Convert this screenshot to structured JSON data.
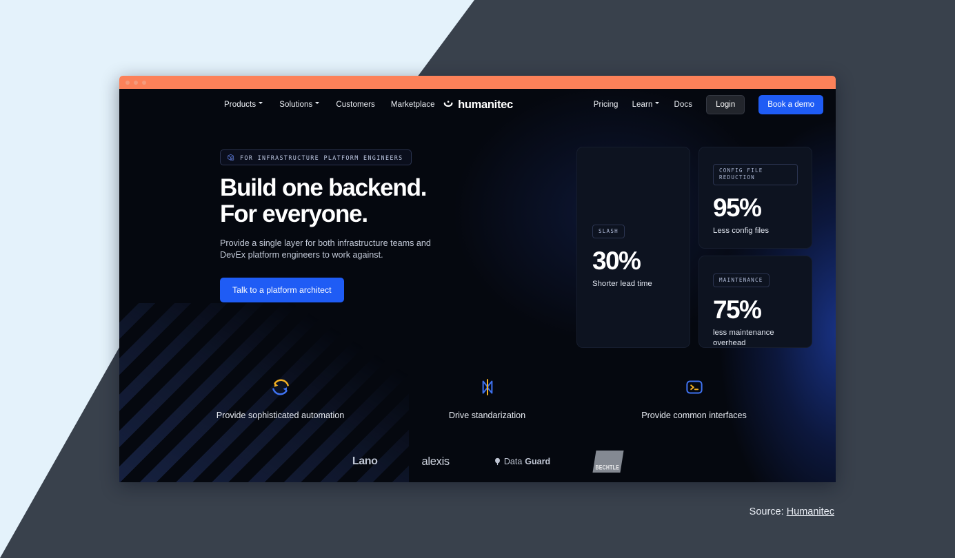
{
  "window": {
    "titlebar_dots": 3
  },
  "nav": {
    "left_items": [
      {
        "label": "Products",
        "has_chevron": true
      },
      {
        "label": "Solutions",
        "has_chevron": true
      },
      {
        "label": "Customers",
        "has_chevron": false
      },
      {
        "label": "Marketplace",
        "has_chevron": false
      }
    ],
    "brand": "humanitec",
    "brand_icon": "humanitec-smile-icon",
    "right_items": [
      {
        "label": "Pricing",
        "has_chevron": false
      },
      {
        "label": "Learn",
        "has_chevron": true
      },
      {
        "label": "Docs",
        "has_chevron": false
      }
    ],
    "login_label": "Login",
    "demo_label": "Book a demo"
  },
  "hero": {
    "eyebrow": "FOR INFRASTRUCTURE PLATFORM ENGINEERS",
    "eyebrow_icon": "cube-config-icon",
    "title_line1": "Build one backend.",
    "title_line2": "For everyone.",
    "subtitle": "Provide a single layer for both infrastructure teams and DevEx platform engineers to work against.",
    "cta_label": "Talk to a platform architect"
  },
  "stats": [
    {
      "tag": "SLASH",
      "value": "30%",
      "label": "Shorter lead time"
    },
    {
      "tag": "CONFIG FILE REDUCTION",
      "value": "95%",
      "label": "Less config files"
    },
    {
      "tag": "MAINTENANCE",
      "value": "75%",
      "label": "less maintenance overhead"
    }
  ],
  "features": [
    {
      "icon": "refresh-cycle-icon",
      "label": "Provide sophisticated automation"
    },
    {
      "icon": "standardization-brackets-icon",
      "label": "Drive standarization"
    },
    {
      "icon": "terminal-prompt-icon",
      "label": "Provide common interfaces"
    }
  ],
  "logos": [
    {
      "name": "lano-logo",
      "text": "Lano"
    },
    {
      "name": "alexis-logo",
      "text": "alexis"
    },
    {
      "name": "dataguard-logo",
      "text_light": "Data",
      "text_bold": "Guard"
    },
    {
      "name": "bechtle-logo",
      "text": "BECHTLE"
    }
  ],
  "caption": {
    "prefix": "Source:",
    "link": "Humanitec"
  },
  "colors": {
    "accent_blue": "#1f5cf5",
    "titlebar_orange": "#fc8159",
    "page_bg": "#e4f2fb",
    "wedge_slate": "#39414c",
    "site_bg": "#05080f",
    "card_bg": "#0d1320",
    "icon_yellow": "#f2b023",
    "icon_blue": "#3f72f0"
  }
}
